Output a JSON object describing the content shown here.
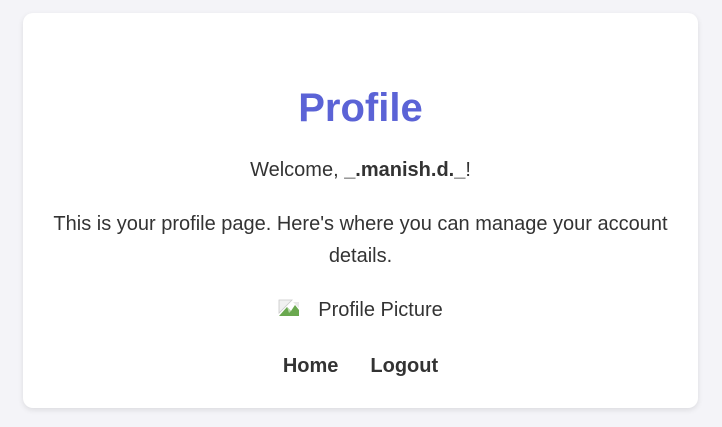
{
  "profile": {
    "title": "Profile",
    "welcome_prefix": "Welcome, ",
    "username": "_.manish.d._",
    "welcome_suffix": "!",
    "description": "This is your profile page. Here's where you can manage your account details.",
    "picture_alt": "Profile Picture",
    "picture_icon": "broken-image-icon"
  },
  "nav": {
    "home_label": "Home",
    "logout_label": "Logout"
  },
  "colors": {
    "title": "#5b63d6",
    "background": "#f4f4f8",
    "card": "#ffffff",
    "text": "#333333"
  }
}
